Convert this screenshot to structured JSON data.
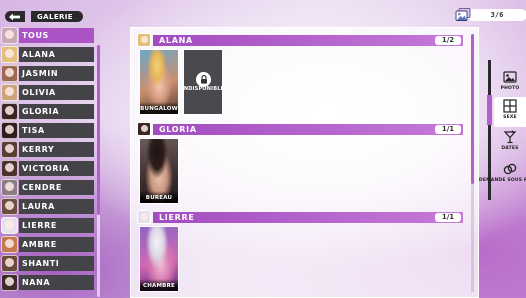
{
  "header": {
    "title": "GALERIE",
    "counter": "3/6"
  },
  "sidebar": {
    "items": [
      {
        "label": "TOUS",
        "active": true,
        "color": "#c9a8b6"
      },
      {
        "label": "ALANA",
        "active": false,
        "color": "#e3c07a"
      },
      {
        "label": "JASMIN",
        "active": false,
        "color": "#9b6a4f"
      },
      {
        "label": "OLIVIA",
        "active": false,
        "color": "#caa57a"
      },
      {
        "label": "GLORIA",
        "active": false,
        "color": "#3b2624"
      },
      {
        "label": "TISA",
        "active": false,
        "color": "#2d1f1c"
      },
      {
        "label": "KERRY",
        "active": false,
        "color": "#5a3d33"
      },
      {
        "label": "VICTORIA",
        "active": false,
        "color": "#4a332c"
      },
      {
        "label": "CENDRE",
        "active": false,
        "color": "#8b7e84"
      },
      {
        "label": "LAURA",
        "active": false,
        "color": "#6e4e3e"
      },
      {
        "label": "LIERRE",
        "active": false,
        "color": "#e6e1ec"
      },
      {
        "label": "AMBRE",
        "active": false,
        "color": "#c27a4e"
      },
      {
        "label": "SHANTI",
        "active": false,
        "color": "#6a4a3a"
      },
      {
        "label": "NANA",
        "active": false,
        "color": "#3c2c2a"
      }
    ]
  },
  "sections": [
    {
      "name": "ALANA",
      "count": "1/2",
      "avatar_color": "#e3c07a",
      "cards": [
        {
          "caption": "BUNGALOW",
          "locked": false,
          "image": "img-bungalow"
        },
        {
          "caption": "INDISPONIBLE",
          "locked": true,
          "image": ""
        }
      ]
    },
    {
      "name": "GLORIA",
      "count": "1/1",
      "avatar_color": "#3b2624",
      "cards": [
        {
          "caption": "BUREAU",
          "locked": false,
          "image": "img-bureau"
        }
      ]
    },
    {
      "name": "LIERRE",
      "count": "1/1",
      "avatar_color": "#e6e1ec",
      "cards": [
        {
          "caption": "CHAMBRE",
          "locked": false,
          "image": "img-chambre"
        }
      ]
    }
  ],
  "filters": [
    {
      "label": "PHOTO",
      "icon": "photo-icon",
      "active": false
    },
    {
      "label": "SEXE",
      "icon": "grid-icon",
      "active": true
    },
    {
      "label": "DATES",
      "icon": "cocktail-icon",
      "active": false
    },
    {
      "label": "DEMANDE SOUS REGLE",
      "icon": "rings-icon",
      "active": false
    }
  ],
  "colors": {
    "accent": "#a953c4",
    "sidebar_item": "#444448"
  }
}
